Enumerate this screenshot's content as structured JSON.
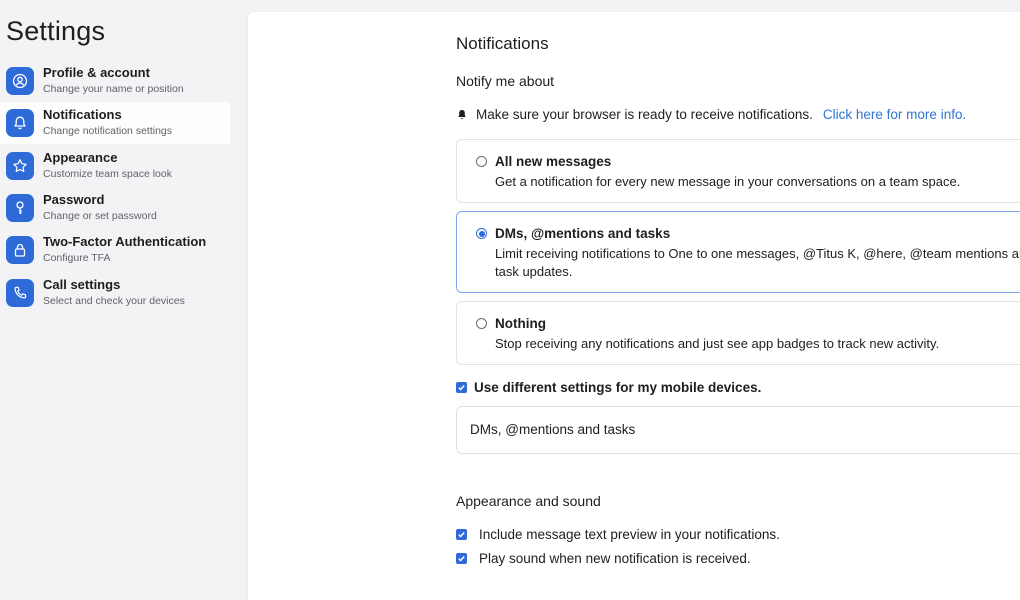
{
  "sidebar": {
    "title": "Settings",
    "items": [
      {
        "label": "Profile & account",
        "sub": "Change your name or position"
      },
      {
        "label": "Notifications",
        "sub": "Change notification settings"
      },
      {
        "label": "Appearance",
        "sub": "Customize team space look"
      },
      {
        "label": "Password",
        "sub": "Change or set password"
      },
      {
        "label": "Two-Factor Authentication",
        "sub": "Configure TFA"
      },
      {
        "label": "Call settings",
        "sub": "Select and check your devices"
      }
    ]
  },
  "main": {
    "title": "Notifications",
    "notify_heading": "Notify me about",
    "info_text": "Make sure your browser is ready to receive notifications.",
    "info_link": "Click here for more info.",
    "options": [
      {
        "title": "All new messages",
        "desc": "Get a notification for every new message in your conversations on a team space."
      },
      {
        "title": "DMs, @mentions and tasks",
        "desc": "Limit receiving notifications to One to one messages, @Titus K, @here, @team mentions and task updates."
      },
      {
        "title": "Nothing",
        "desc": "Stop receiving any notifications and just see app badges to track new activity."
      }
    ],
    "mobile_label": "Use different settings for my mobile devices.",
    "mobile_select_value": "DMs, @mentions and tasks",
    "appearance_heading": "Appearance and sound",
    "preview_label": "Include message text preview in your notifications.",
    "sound_label": "Play sound when new notification is received."
  },
  "colors": {
    "accent": "#2f6ad9",
    "link": "#2f76d2",
    "selected_border": "#7aa8e8"
  }
}
